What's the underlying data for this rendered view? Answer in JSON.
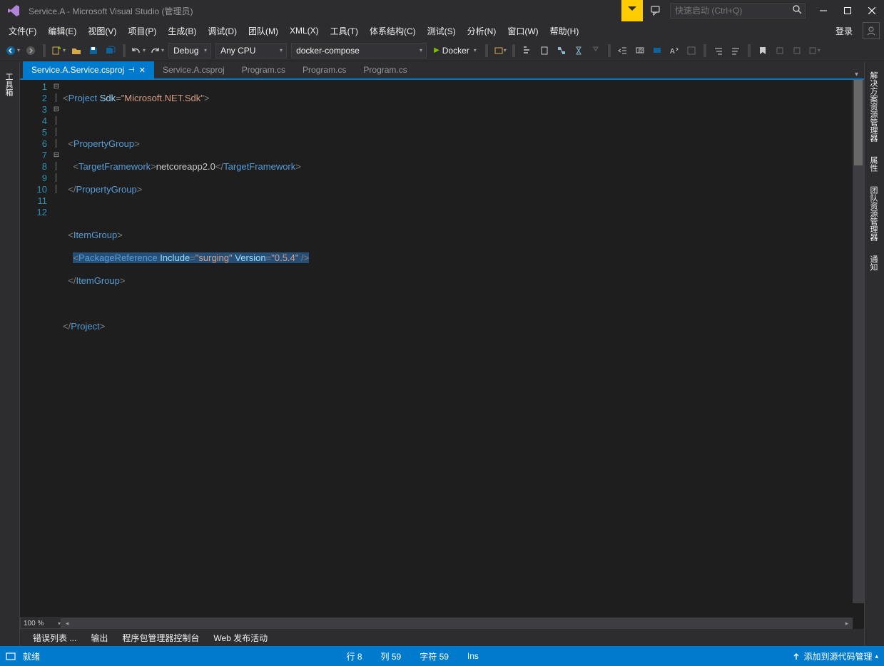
{
  "title": "Service.A - Microsoft Visual Studio  (管理员)",
  "search_placeholder": "快速启动 (Ctrl+Q)",
  "menu": [
    "文件(F)",
    "编辑(E)",
    "视图(V)",
    "项目(P)",
    "生成(B)",
    "调试(D)",
    "团队(M)",
    "XML(X)",
    "工具(T)",
    "体系结构(C)",
    "测试(S)",
    "分析(N)",
    "窗口(W)",
    "帮助(H)"
  ],
  "login": "登录",
  "toolbar": {
    "config": "Debug",
    "platform": "Any CPU",
    "startup": "docker-compose",
    "run": "Docker"
  },
  "left_tabs": [
    "工具箱"
  ],
  "right_tabs": [
    "解决方案资源管理器",
    "属性",
    "团队资源管理器",
    "通知"
  ],
  "file_tabs": [
    {
      "label": "Service.A.Service.csproj",
      "active": true,
      "pinned": true
    },
    {
      "label": "Service.A.csproj",
      "active": false
    },
    {
      "label": "Program.cs",
      "active": false
    },
    {
      "label": "Program.cs",
      "active": false
    },
    {
      "label": "Program.cs",
      "active": false
    }
  ],
  "zoom": "100 %",
  "code": {
    "lines": 12,
    "selected_line": 8,
    "l1": {
      "tag": "Project",
      "attr": "Sdk",
      "val": "\"Microsoft.NET.Sdk\""
    },
    "l3": {
      "tag": "PropertyGroup"
    },
    "l4": {
      "tag": "TargetFramework",
      "txt": "netcoreapp2.0"
    },
    "l5": {
      "tag": "PropertyGroup"
    },
    "l7": {
      "tag": "ItemGroup"
    },
    "l8": {
      "tag": "PackageReference",
      "a1": "Include",
      "v1": "\"surging\"",
      "a2": "Version",
      "v2": "\"0.5.4\""
    },
    "l9": {
      "tag": "ItemGroup"
    },
    "l11": {
      "tag": "Project"
    }
  },
  "output_tabs": [
    "错误列表 ...",
    "输出",
    "程序包管理器控制台",
    "Web 发布活动"
  ],
  "status": {
    "ready": "就绪",
    "line": "行 8",
    "col": "列 59",
    "char": "字符 59",
    "ins": "Ins",
    "src": "添加到源代码管理"
  }
}
